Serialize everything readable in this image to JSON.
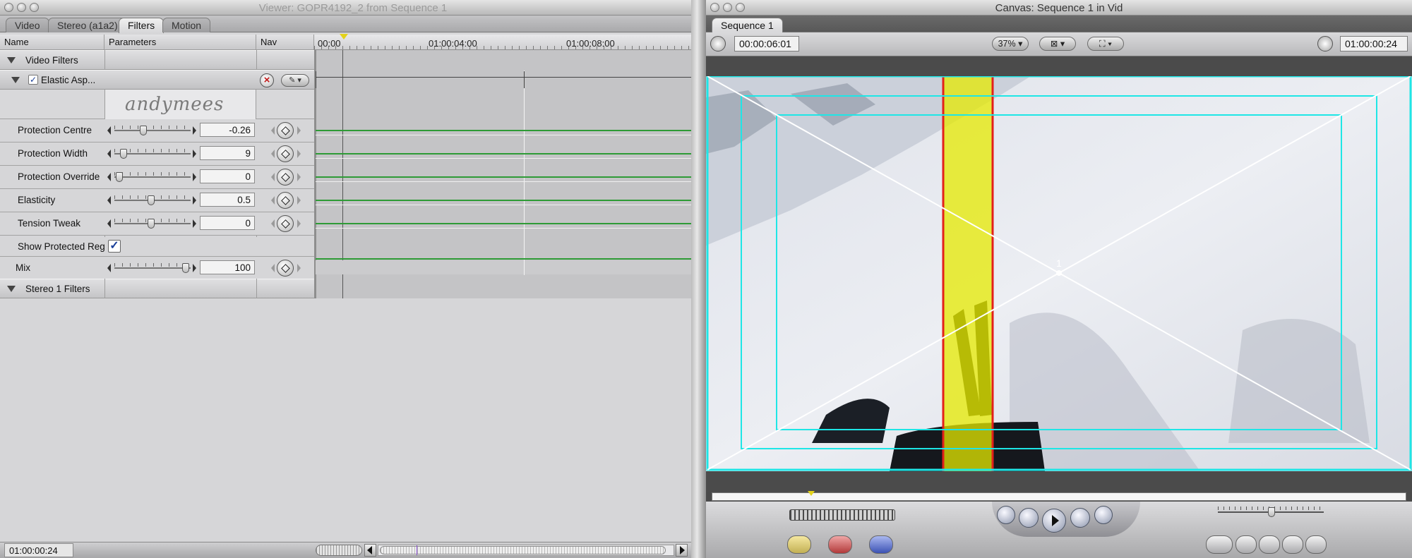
{
  "viewer": {
    "title": "Viewer: GOPR4192_2 from Sequence 1",
    "tabs": [
      "Video",
      "Stereo (a1a2)",
      "Filters",
      "Motion"
    ],
    "active_tab": "Filters",
    "columns": {
      "name": "Name",
      "parameters": "Parameters",
      "nav": "Nav"
    },
    "ruler": [
      "00:00",
      "01:00:04:00",
      "01:00:08:00"
    ],
    "group_video": "Video Filters",
    "filter_name": "Elastic Asp...",
    "logo_text": "andymees",
    "params": [
      {
        "label": "Protection Centre",
        "value": "-0.26",
        "level": 0.37
      },
      {
        "label": "Protection Width",
        "value": "9",
        "level": 0.08
      },
      {
        "label": "Protection Override",
        "value": "0",
        "level": 0.02
      },
      {
        "label": "Elasticity",
        "value": "0.5",
        "level": 0.48
      },
      {
        "label": "Tension Tweak",
        "value": "0",
        "level": 0.48
      }
    ],
    "show_protected_label": "Show Protected Reg",
    "show_protected_checked": true,
    "mix": {
      "label": "Mix",
      "value": "100",
      "level": 0.98
    },
    "group_stereo": "Stereo 1 Filters",
    "timecode": "01:00:00:24"
  },
  "canvas": {
    "title": "Canvas: Sequence 1 in Vid",
    "tab": "Sequence 1",
    "duration_tc": "00:00:06:01",
    "zoom": "37%",
    "current_tc": "01:00:00:24",
    "overlay_number": "1"
  },
  "colors": {
    "overlay_cyan": "#1ee6e6",
    "protected_yellow": "#e6ea00",
    "protected_red": "#e3201a",
    "keyframe_green": "#2e9b36"
  }
}
